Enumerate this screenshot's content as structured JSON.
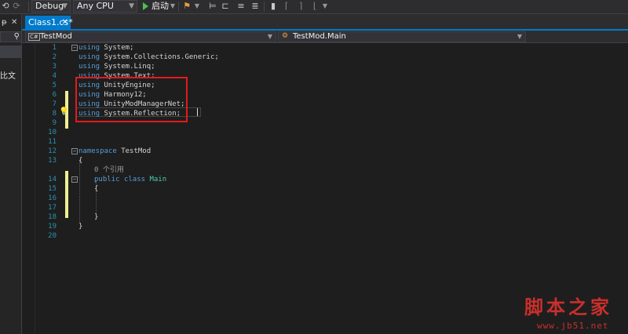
{
  "toolbar": {
    "config": "Debug",
    "platform": "Any CPU",
    "start_label": "启动",
    "icons": [
      "undo-icon",
      "redo-icon",
      "start-icon",
      "browser-link-icon",
      "step-icon",
      "align-icon",
      "comment-icon",
      "uncomment-icon",
      "bookmark-icon",
      "bookmark-prev-icon",
      "bookmark-next-icon",
      "bookmark-clear-icon"
    ]
  },
  "left_panel": {
    "pin": "ᵽ",
    "close": "✕",
    "search_icon": "⚲",
    "label": "比文"
  },
  "tab": {
    "label": "Class1.cs*",
    "close": "✕"
  },
  "navbar": {
    "project": "TestMod",
    "project_icon": "C#",
    "member": "TestMod.Main"
  },
  "editor": {
    "lines": [
      {
        "n": "1"
      },
      {
        "n": "2"
      },
      {
        "n": "3"
      },
      {
        "n": "4"
      },
      {
        "n": "5"
      },
      {
        "n": "6"
      },
      {
        "n": "7"
      },
      {
        "n": "8"
      },
      {
        "n": "9"
      },
      {
        "n": "10"
      },
      {
        "n": "11"
      },
      {
        "n": "12"
      },
      {
        "n": "13"
      },
      {
        "n": "14"
      },
      {
        "n": "15"
      },
      {
        "n": "16"
      },
      {
        "n": "17"
      },
      {
        "n": "18"
      },
      {
        "n": "19"
      },
      {
        "n": "20"
      }
    ],
    "using_kw": "using",
    "usings": [
      "System;",
      "System.Collections.Generic;",
      "System.Linq;",
      "System.Text;",
      "UnityEngine;",
      "Harmony12;",
      "UnityModManagerNet;",
      "System.Reflection;"
    ],
    "namespace_kw": "namespace",
    "namespace_name": "TestMod",
    "open_brace": "{",
    "close_brace": "}",
    "references": "0 个引用",
    "public_kw": "public",
    "class_kw": "class",
    "class_name": "Main"
  },
  "watermark": {
    "cn": "脚本之家",
    "url": "www.jb51.net"
  },
  "colors": {
    "accent": "#007acc",
    "keyword": "#569cd6",
    "type": "#4ec9b0",
    "line_number": "#2b91af",
    "highlight_box": "#e51a1a",
    "change_marker": "#efef91"
  }
}
